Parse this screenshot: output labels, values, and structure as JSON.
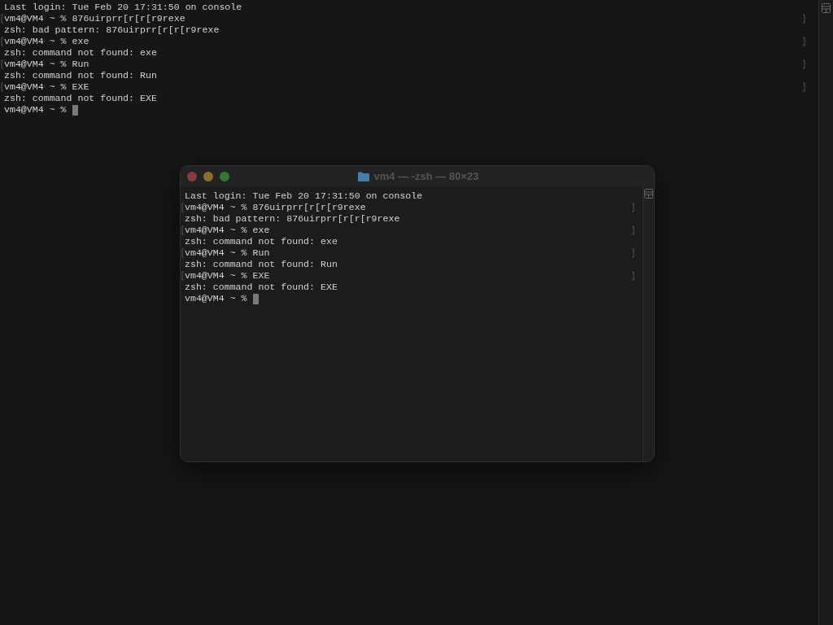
{
  "background_terminal": {
    "lines": [
      {
        "text": "Last login: Tue Feb 20 17:31:50 on console",
        "marked": false,
        "cursor": false
      },
      {
        "text": "vm4@VM4 ~ % 876uirprr[r[r[r9rexe",
        "marked": true,
        "cursor": false
      },
      {
        "text": "zsh: bad pattern: 876uirprr[r[r[r9rexe",
        "marked": false,
        "cursor": false
      },
      {
        "text": "vm4@VM4 ~ % exe",
        "marked": true,
        "cursor": false
      },
      {
        "text": "zsh: command not found: exe",
        "marked": false,
        "cursor": false
      },
      {
        "text": "vm4@VM4 ~ % Run",
        "marked": true,
        "cursor": false
      },
      {
        "text": "zsh: command not found: Run",
        "marked": false,
        "cursor": false
      },
      {
        "text": "vm4@VM4 ~ % EXE",
        "marked": true,
        "cursor": false
      },
      {
        "text": "zsh: command not found: EXE",
        "marked": false,
        "cursor": false
      },
      {
        "text": "vm4@VM4 ~ %",
        "marked": false,
        "cursor": true
      }
    ]
  },
  "window": {
    "title": "vm4 — -zsh — 80×23",
    "lines": [
      {
        "text": "Last login: Tue Feb 20 17:31:50 on console",
        "marked": false,
        "cursor": false
      },
      {
        "text": "vm4@VM4 ~ % 876uirprr[r[r[r9rexe",
        "marked": true,
        "cursor": false
      },
      {
        "text": "zsh: bad pattern: 876uirprr[r[r[r9rexe",
        "marked": false,
        "cursor": false
      },
      {
        "text": "vm4@VM4 ~ % exe",
        "marked": true,
        "cursor": false
      },
      {
        "text": "zsh: command not found: exe",
        "marked": false,
        "cursor": false
      },
      {
        "text": "vm4@VM4 ~ % Run",
        "marked": true,
        "cursor": false
      },
      {
        "text": "zsh: command not found: Run",
        "marked": false,
        "cursor": false
      },
      {
        "text": "vm4@VM4 ~ % EXE",
        "marked": true,
        "cursor": false
      },
      {
        "text": "zsh: command not found: EXE",
        "marked": false,
        "cursor": false
      },
      {
        "text": "vm4@VM4 ~ %",
        "marked": false,
        "cursor": true
      }
    ]
  }
}
